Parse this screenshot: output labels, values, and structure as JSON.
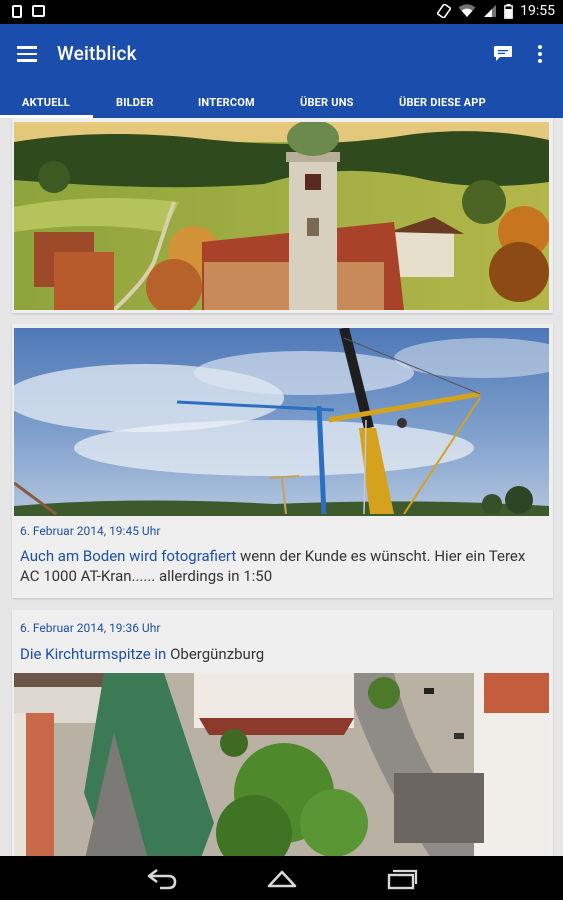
{
  "status_bar": {
    "time": "19:55"
  },
  "app": {
    "title": "Weitblick",
    "accent": "#1b4dac"
  },
  "tabs": [
    {
      "label": "AKTUELL"
    },
    {
      "label": "BILDER"
    },
    {
      "label": "INTERCOM"
    },
    {
      "label": "ÜBER UNS"
    },
    {
      "label": "ÜBER DIESE APP"
    }
  ],
  "posts": [
    {
      "image": "aerial-church-tower-landscape"
    },
    {
      "image": "crane-against-blue-sky",
      "date": "6. Februar 2014, 19:45 Uhr",
      "title": "Auch am Boden wird fotografiert",
      "text": " wenn der Kunde es wünscht. Hier ein Terex AC 1000 AT-Kran...... allerdings in 1:50"
    },
    {
      "image": "aerial-church-spire-town",
      "date": "6. Februar 2014, 19:36 Uhr",
      "title": "Die Kirchturmspitze in",
      "text": " Obergünzburg"
    }
  ],
  "icons": {
    "menu": "hamburger-menu-icon",
    "chat": "chat-bubble-icon",
    "more": "overflow-menu-icon",
    "back": "back-icon",
    "home": "home-icon",
    "recents": "recent-apps-icon"
  }
}
